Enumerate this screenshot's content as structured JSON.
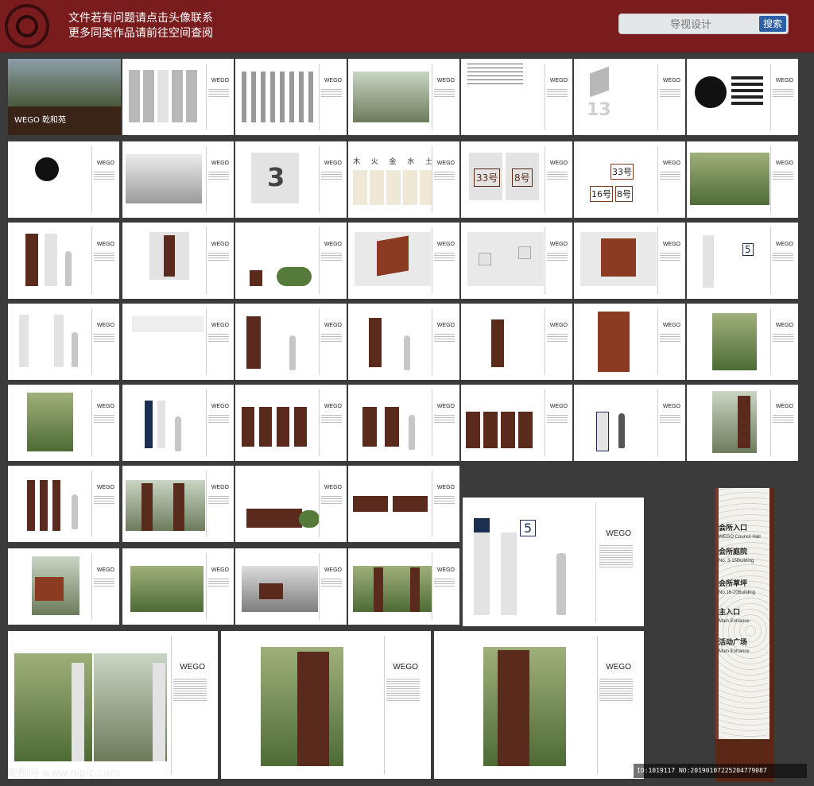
{
  "banner": {
    "line1": "文件若有问题请点击头像联系",
    "line2": "更多同类作品请前往空间查阅"
  },
  "search": {
    "placeholder": "导视设计",
    "button_label": "搜索"
  },
  "thumbs": {
    "brand": "WEGO",
    "cover_title": "WEGO 乾和苑",
    "element_labels": [
      "木",
      "火",
      "金",
      "水",
      "土"
    ],
    "room_numbers": [
      "33号",
      "8号",
      "16号",
      "8号"
    ],
    "big_number": "13",
    "number_3": "3",
    "number_5": "5",
    "featured_wego": "WEGO"
  },
  "pylon": {
    "items": [
      {
        "cn": "会所入口",
        "en": "WEGO Council Hall"
      },
      {
        "cn": "会所庭院",
        "en": "No. 3-15Building"
      },
      {
        "cn": "会所草坪",
        "en": "No.16-20Building"
      },
      {
        "cn": "主入口",
        "en": "Main Entrance"
      },
      {
        "cn": "活动广场",
        "en": "Main Entrance"
      }
    ]
  },
  "footer": {
    "watermark": "昵图网 www.nipic.com",
    "id_text": "ID:1019117 NO:20190107225204779087"
  },
  "colors": {
    "banner": "#7a1c1e",
    "background": "#3b3b3b",
    "search_button": "#2b5fa6",
    "sign_brown": "#5a2a1c"
  }
}
